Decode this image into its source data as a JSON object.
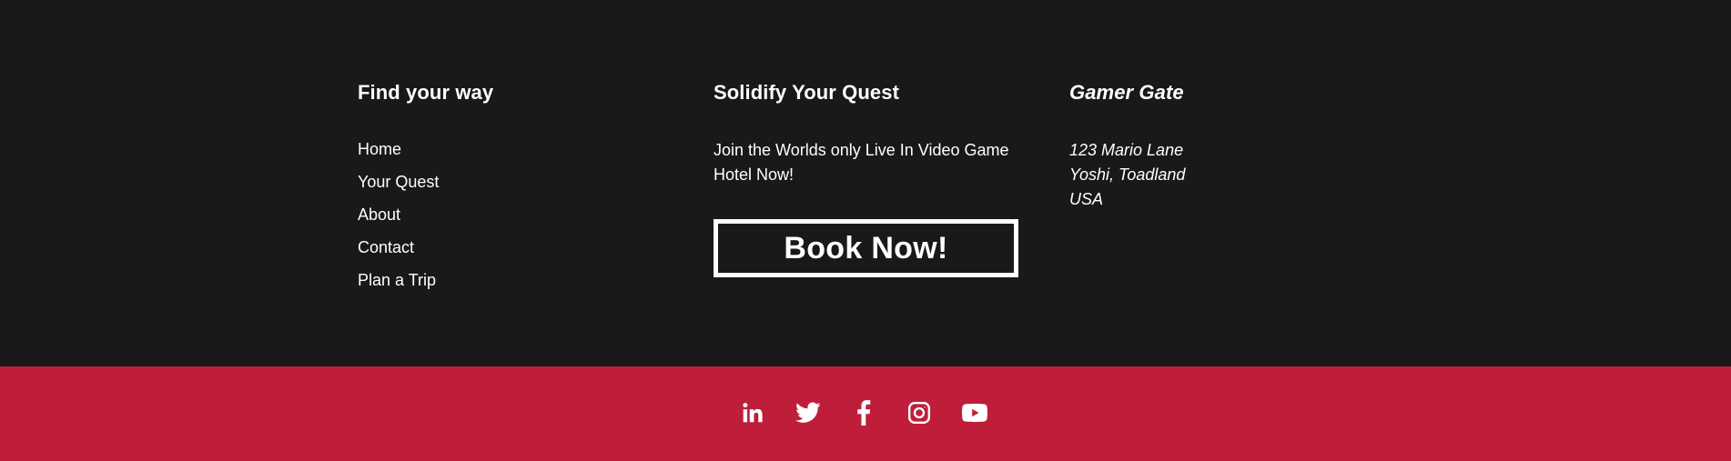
{
  "footer": {
    "nav": {
      "title": "Find your way",
      "links": [
        "Home",
        "Your Quest",
        "About",
        "Contact",
        "Plan a Trip"
      ]
    },
    "quest": {
      "title": "Solidify Your Quest",
      "text": "Join the Worlds only Live In Video Game Hotel Now!",
      "button_label": "Book Now!"
    },
    "gate": {
      "title": "Gamer Gate",
      "address": [
        "123 Mario Lane",
        "Yoshi, Toadland",
        "USA"
      ]
    },
    "social": {
      "icons": [
        "linkedin-icon",
        "twitter-icon",
        "facebook-icon",
        "instagram-icon",
        "youtube-icon"
      ]
    }
  },
  "colors": {
    "footer_background": "#191919",
    "bar_background": "#be1e3a",
    "text": "#ffffff"
  }
}
